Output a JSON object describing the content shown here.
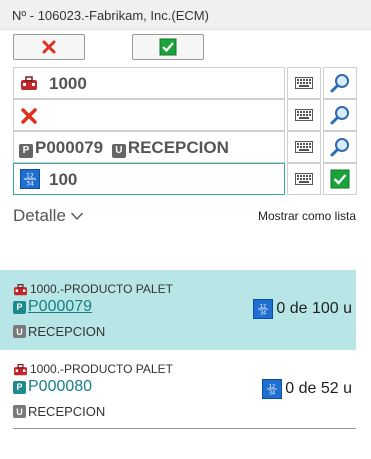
{
  "window": {
    "title": "Nº - 106023.-Fabrikam, Inc.(ECM)"
  },
  "colors": {
    "accent": "#3aa6a0",
    "selected_row": "#b8e6e6",
    "link": "#177f84",
    "cancel": "#e0301e",
    "confirm": "#1aa33a"
  },
  "toolbar": {
    "cancel_icon": "red-x-icon",
    "ok_icon": "green-check-icon"
  },
  "fields": [
    {
      "icon": "toolbox-icon",
      "value": "1000"
    },
    {
      "icon": "red-x-icon",
      "value": ""
    },
    {
      "pallet_badge": "P",
      "pallet": "P000079",
      "location_badge": "U",
      "location": "RECEPCION"
    },
    {
      "icon": "quantity-icon",
      "value": "100"
    }
  ],
  "detail": {
    "label": "Detalle",
    "list_toggle": "Mostrar como lista"
  },
  "items": [
    {
      "product": "1000.-PRODUCTO PALET",
      "pallet_badge": "P",
      "pallet": "P000079",
      "quantity": "0 de 100 u",
      "location_badge": "U",
      "location": "RECEPCION"
    },
    {
      "product": "1000.-PRODUCTO PALET",
      "pallet_badge": "P",
      "pallet": "P000080",
      "quantity": "0 de 52 u",
      "location_badge": "U",
      "location": "RECEPCION"
    }
  ]
}
